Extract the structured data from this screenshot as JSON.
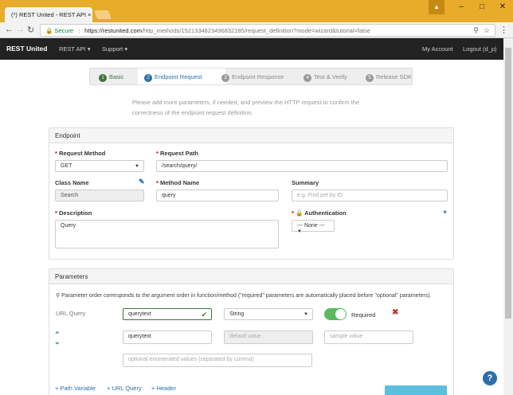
{
  "browser": {
    "tab_title": "(*) REST United - REST API ×",
    "url_secure": "Secure",
    "url_host": "https://restunited.com",
    "url_path": "/http_methods/1521334623496832185/request_definition?mode=wizard&tutorial=false"
  },
  "navbar": {
    "brand": "REST United",
    "rest_api": "REST API ▾",
    "support": "Support ▾",
    "my_account": "My Account",
    "logout": "Logout (d_p)"
  },
  "wizard": {
    "steps": [
      {
        "num": "1",
        "label": "Basic"
      },
      {
        "num": "2",
        "label": "Endpoint Request"
      },
      {
        "num": "3",
        "label": "Endpoint Response"
      },
      {
        "num": "4",
        "label": "Test & Verify"
      },
      {
        "num": "5",
        "label": "Release SDK"
      }
    ]
  },
  "intro": "Please add more parameters, if needed, and preview the HTTP request to confirm the correctness of the endpoint request definition.",
  "endpoint": {
    "heading": "Endpoint",
    "request_method_label": "Request Method",
    "request_method_value": "GET",
    "request_path_label": "Request Path",
    "request_path_value": "/search/query/",
    "class_name_label": "Class Name",
    "class_name_value": "Search",
    "method_name_label": "Method Name",
    "method_name_value": "query",
    "summary_label": "Summary",
    "summary_placeholder": "e.g. Find pet by ID",
    "description_label": "Description",
    "description_value": "Query",
    "authentication_label": "Authentication",
    "authentication_value": "--- None ---"
  },
  "parameters": {
    "heading": "Parameters",
    "note": "Parameter order corresponds to the argument order in function/method (\"required\" parameters are automatically placed before \"optional\" parameters).",
    "row_label": "URL Query",
    "name_value": "querytext",
    "type_value": "String",
    "required_label": "Required",
    "description_value": "querytext",
    "default_placeholder": "default value",
    "sample_placeholder": "sample value",
    "enum_placeholder": "optional enumerated values (separated by comma)",
    "add_path_variable": "+ Path Variable",
    "add_url_query": "+ URL Query",
    "add_header": "+ Header"
  },
  "colors": {
    "accent": "#2a6fa8",
    "success": "#3c763d",
    "toggle": "#5cb85c",
    "browser": "#e8ab2a"
  }
}
